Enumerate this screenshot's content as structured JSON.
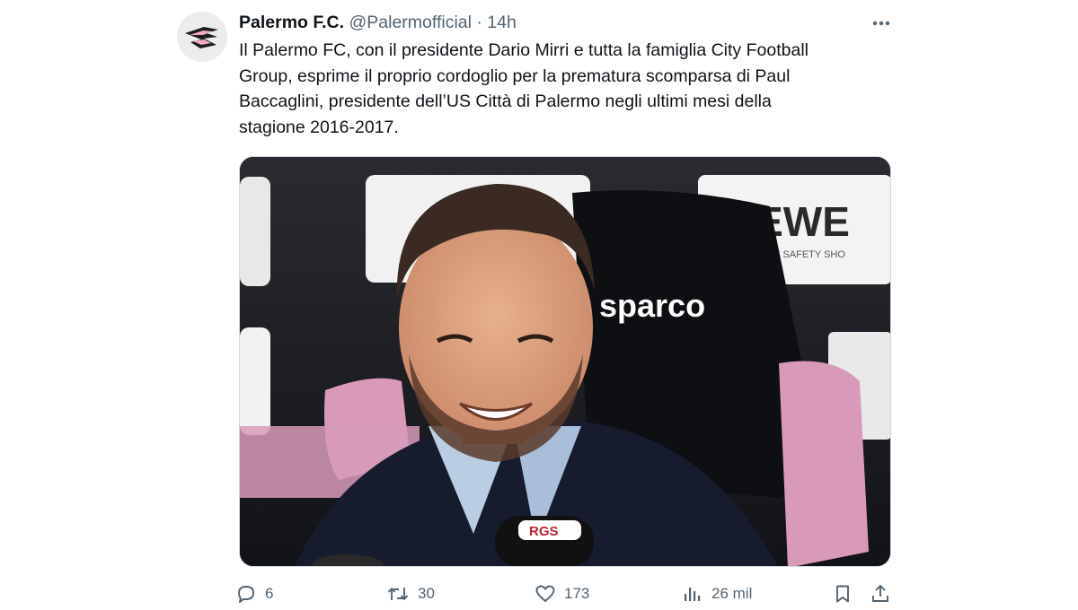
{
  "account": {
    "name": "Palermo F.C.",
    "handle": "@Palermofficial",
    "separator": "·",
    "time": "14h",
    "avatar_icon": "palermo-eagle-logo-icon"
  },
  "more_icon": "more-horizontal-icon",
  "tweet": {
    "text": "Il Palermo FC, con il presidente Dario Mirri e tutta la famiglia City Football\nGroup, esprime il proprio cordoglio per la prematura scomparsa di Paul\nBaccaglini, presidente dell’US Città di Palermo negli ultimi mesi della\nstagione 2016-2017."
  },
  "photo": {
    "sponsor_text": "LEWE",
    "sponsor_subtext": "LAN SAFETY SHO",
    "chair_brand": "sparco",
    "mic_brand": "RGS"
  },
  "actions": {
    "replies": {
      "icon": "reply-icon",
      "count": "6"
    },
    "retweets": {
      "icon": "retweet-icon",
      "count": "30"
    },
    "likes": {
      "icon": "like-icon",
      "count": "173"
    },
    "views": {
      "icon": "views-icon",
      "count": "26 mil"
    },
    "bookmark_icon": "bookmark-icon",
    "share_icon": "share-icon"
  },
  "colors": {
    "text": "#0f1419",
    "secondary": "#536471",
    "border": "#cfd9de",
    "chair_pink": "#d89ab8"
  }
}
